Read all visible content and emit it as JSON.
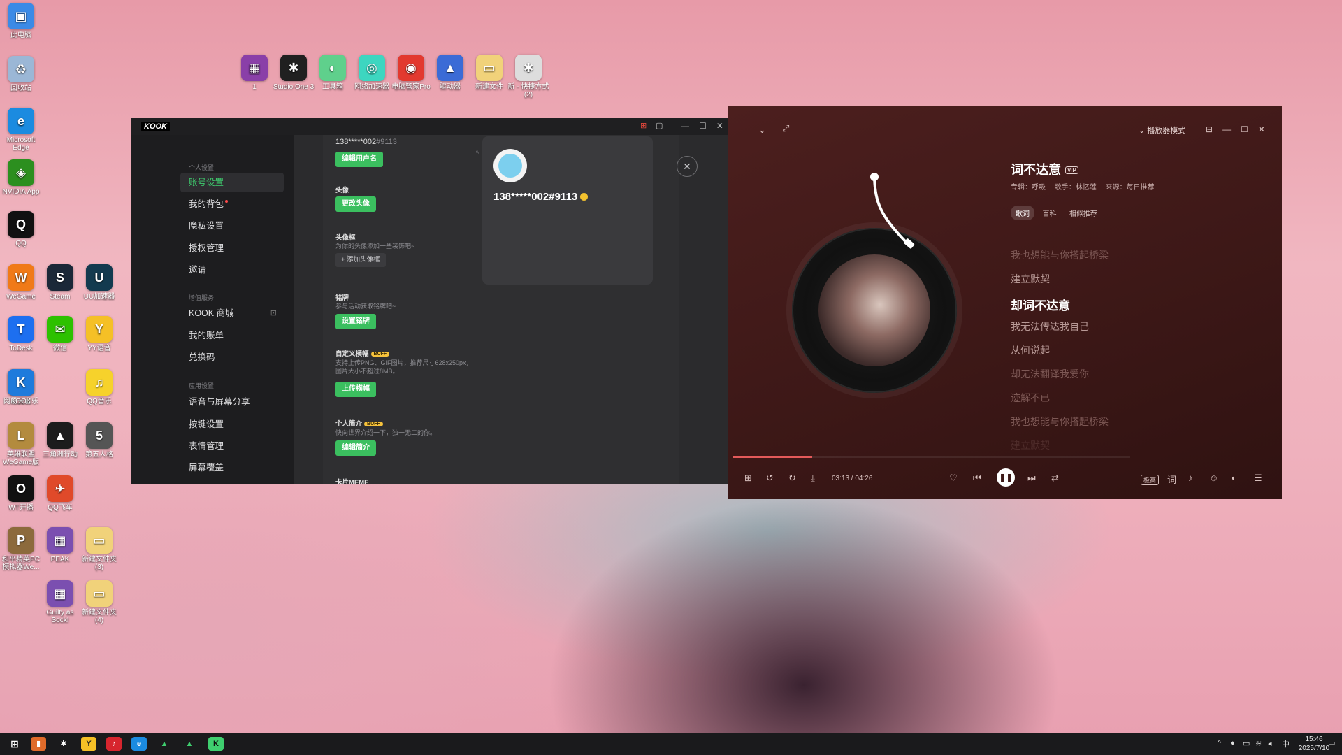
{
  "desktop": {
    "left_icons": [
      {
        "label": "此电脑",
        "color": "#3b8ae6",
        "glyph": "▣"
      },
      {
        "label": "回收站",
        "color": "#9bb7d6",
        "glyph": "♻"
      },
      {
        "label": "Microsoft Edge",
        "color": "#1b8be0",
        "glyph": "e"
      },
      {
        "label": "NVIDIA App",
        "color": "#2c8f1f",
        "glyph": "◈"
      },
      {
        "label": "QQ",
        "color": "#111111",
        "glyph": "Q"
      },
      {
        "label": "WeGame",
        "color": "#f07a18",
        "glyph": "W"
      },
      {
        "label": "ToDesk",
        "color": "#1d6ff0",
        "glyph": "T"
      },
      {
        "label": "网易云音乐",
        "color": "#d7252e",
        "glyph": "♪"
      },
      {
        "label": "英雄联盟WeGame版",
        "color": "#b38b3e",
        "glyph": "L"
      },
      {
        "label": "WT开播",
        "color": "#111111",
        "glyph": "O"
      },
      {
        "label": "和平精英PC模拟器We...",
        "color": "#8c6a3c",
        "glyph": "P"
      },
      {
        "label": "Steam",
        "color": "#1b2838",
        "glyph": "S"
      },
      {
        "label": "微信",
        "color": "#2dc100",
        "glyph": "✉"
      },
      {
        "label": "QQ音乐",
        "color": "#f6d22b",
        "glyph": "♫"
      },
      {
        "label": "三角洲行动",
        "color": "#1c1c1c",
        "glyph": "▲"
      },
      {
        "label": "QQ飞车",
        "color": "#e04a2a",
        "glyph": "✈"
      },
      {
        "label": "PEAK",
        "color": "#7b4fb0",
        "glyph": "▦"
      },
      {
        "label": "Guilty as Sock!",
        "color": "#7b4fb0",
        "glyph": "▦"
      },
      {
        "label": "UU加速器",
        "color": "#133a4f",
        "glyph": "U"
      },
      {
        "label": "YY语音",
        "color": "#f5c026",
        "glyph": "Y"
      },
      {
        "label": "第五人格",
        "color": "#555555",
        "glyph": "5"
      },
      {
        "label": "新建文件夹(3)",
        "color": "#f1d27a",
        "glyph": "▭"
      },
      {
        "label": "新建文件夹(4)",
        "color": "#f1d27a",
        "glyph": "▭"
      },
      {
        "label": "KOOK",
        "color": "#1e7bdc",
        "glyph": "K"
      }
    ],
    "top_icons": [
      {
        "label": "1",
        "color": "#8a3fa8",
        "glyph": "▦"
      },
      {
        "label": "Studio One 3",
        "color": "#202020",
        "glyph": "✱"
      },
      {
        "label": "工具箱",
        "color": "#5fd08c",
        "glyph": "◐"
      },
      {
        "label": "网络加速器",
        "color": "#3dd6c0",
        "glyph": "◎"
      },
      {
        "label": "电脑管家Pro",
        "color": "#e2392f",
        "glyph": "◉"
      },
      {
        "label": "驱动器",
        "color": "#3b6bd6",
        "glyph": "▲"
      },
      {
        "label": "新建文件",
        "color": "#f1d27a",
        "glyph": "▭"
      },
      {
        "label": "新 - 快捷方式 (2)",
        "color": "#dddddd",
        "glyph": "✱"
      }
    ]
  },
  "kook": {
    "logo": "KOOK",
    "sidebar": {
      "groups": [
        "个人设置",
        "增值服务",
        "应用设置"
      ],
      "items": [
        {
          "label": "账号设置",
          "active": true
        },
        {
          "label": "我的背包",
          "dot": true
        },
        {
          "label": "隐私设置"
        },
        {
          "label": "授权管理"
        },
        {
          "label": "邀请"
        },
        {
          "label": "KOOK 商城"
        },
        {
          "label": "我的账单"
        },
        {
          "label": "兑换码"
        },
        {
          "label": "语音与屏幕分享"
        },
        {
          "label": "按键设置"
        },
        {
          "label": "表情管理"
        },
        {
          "label": "屏幕覆盖"
        }
      ]
    },
    "content": {
      "username_line": "138*****002",
      "username_tag": "#9113",
      "edit_username": "编辑用户名",
      "avatar_title": "头像",
      "change_avatar": "更改头像",
      "frame_title": "头像框",
      "frame_desc": "为你的头像添加一些装饰吧~",
      "add_frame": "+ 添加头像框",
      "badge_title": "铭牌",
      "badge_desc": "参与活动获取铭牌吧~",
      "set_badge": "设置铭牌",
      "banner_title": "自定义横幅",
      "buff": "BUFF",
      "banner_desc": "支持上传PNG、GIF图片，推荐尺寸628x250px，图片大小不超过8MB。",
      "upload_banner": "上传横幅",
      "bio_title": "个人简介",
      "bio_desc": "快向世界介绍一下，独一无二的你。",
      "edit_bio": "编辑简介",
      "card_meme": "卡片MEME"
    },
    "profile": {
      "name": "138*****002#9113"
    }
  },
  "music": {
    "mode_button": "播放器模式",
    "song_title": "词不达意",
    "vip": "VIP",
    "meta": {
      "album": "专辑：呼吸",
      "artist": "歌手：林忆莲",
      "source": "来源：每日推荐"
    },
    "tabs": [
      "歌词",
      "百科",
      "相似推荐"
    ],
    "lyrics": [
      {
        "text": "我也想能与你搭起桥梁",
        "state": "faint"
      },
      {
        "text": "建立默契",
        "state": "normal"
      },
      {
        "text": "却词不达意",
        "state": "active"
      },
      {
        "text": "我无法传达我自己",
        "state": "normal"
      },
      {
        "text": "从何说起",
        "state": "normal"
      },
      {
        "text": "却无法翻译我爱你",
        "state": "faint"
      },
      {
        "text": "迹解不已",
        "state": "faint"
      },
      {
        "text": "我也想能与你搭起桥梁",
        "state": "faint"
      },
      {
        "text": "建立默契",
        "state": "faint"
      }
    ],
    "time": "03:13 / 04:26",
    "progress_fraction": 0.2,
    "quality": "极高"
  },
  "taskbar": {
    "time": "15:46",
    "date": "2025/7/10",
    "ime": "中"
  }
}
